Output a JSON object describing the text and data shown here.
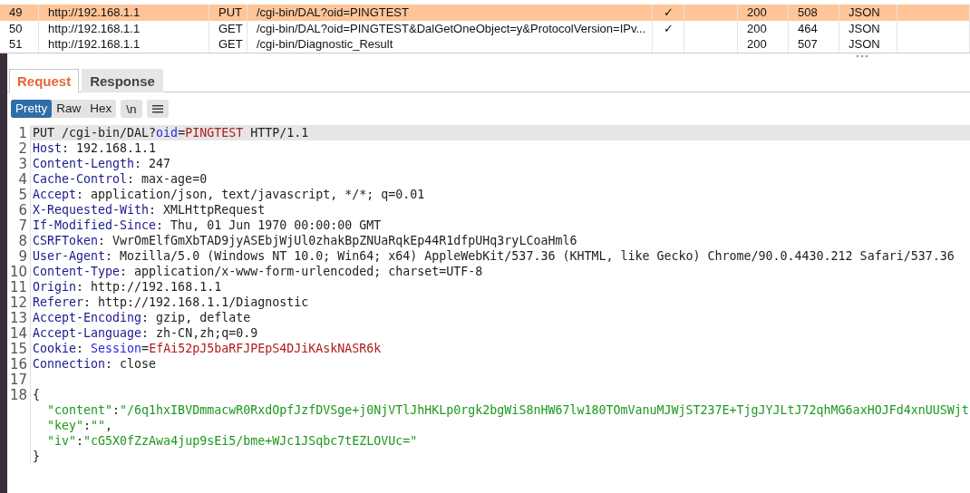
{
  "history": {
    "rows": [
      {
        "number": "49",
        "host": "http://192.168.1.1",
        "method": "PUT",
        "url": "/cgi-bin/DAL?oid=PINGTEST",
        "edited": "✓",
        "status": "200",
        "length": "508",
        "mime": "JSON",
        "selected": true
      },
      {
        "number": "50",
        "host": "http://192.168.1.1",
        "method": "GET",
        "url": "/cgi-bin/DAL?oid=PINGTEST&DalGetOneObject=y&ProtocolVersion=IPv...",
        "edited": "✓",
        "status": "200",
        "length": "464",
        "mime": "JSON",
        "selected": false
      },
      {
        "number": "51",
        "host": "http://192.168.1.1",
        "method": "GET",
        "url": "/cgi-bin/Diagnostic_Result",
        "status": "200",
        "length": "507",
        "mime": "JSON",
        "selected": false
      }
    ]
  },
  "tabs": [
    {
      "label": "Request",
      "selected": true
    },
    {
      "label": "Response",
      "selected": false
    }
  ],
  "view_modes": [
    {
      "label": "Pretty",
      "selected": true
    },
    {
      "label": "Raw",
      "selected": false
    },
    {
      "label": "Hex",
      "selected": false
    }
  ],
  "newline_toggle": "\\n",
  "request": {
    "lines": [
      {
        "number": "1",
        "highlighted": true,
        "parts": [
          {
            "kind": "text",
            "text": "PUT /cgi-bin/DAL?"
          },
          {
            "kind": "param",
            "text": "oid"
          },
          {
            "kind": "text",
            "text": "="
          },
          {
            "kind": "value",
            "text": "PINGTEST"
          },
          {
            "kind": "text",
            "text": " HTTP/1.1"
          }
        ]
      },
      {
        "number": "2",
        "highlighted": false,
        "parts": [
          {
            "kind": "name",
            "text": "Host"
          },
          {
            "kind": "text",
            "text": ": 192.168.1.1"
          }
        ]
      },
      {
        "number": "3",
        "highlighted": false,
        "parts": [
          {
            "kind": "name",
            "text": "Content-Length"
          },
          {
            "kind": "text",
            "text": ": 247"
          }
        ]
      },
      {
        "number": "4",
        "highlighted": false,
        "parts": [
          {
            "kind": "name",
            "text": "Cache-Control"
          },
          {
            "kind": "text",
            "text": ": max-age=0"
          }
        ]
      },
      {
        "number": "5",
        "highlighted": false,
        "parts": [
          {
            "kind": "name",
            "text": "Accept"
          },
          {
            "kind": "text",
            "text": ": application/json, text/javascript, */*; q=0.01"
          }
        ]
      },
      {
        "number": "6",
        "highlighted": false,
        "parts": [
          {
            "kind": "name",
            "text": "X-Requested-With"
          },
          {
            "kind": "text",
            "text": ": XMLHttpRequest"
          }
        ]
      },
      {
        "number": "7",
        "highlighted": false,
        "parts": [
          {
            "kind": "name",
            "text": "If-Modified-Since"
          },
          {
            "kind": "text",
            "text": ": Thu, 01 Jun 1970 00:00:00 GMT"
          }
        ]
      },
      {
        "number": "8",
        "highlighted": false,
        "parts": [
          {
            "kind": "name",
            "text": "CSRFToken"
          },
          {
            "kind": "text",
            "text": ": VwrOmElfGmXbTAD9jyASEbjWjUl0zhakBpZNUaRqkEp44R1dfpUHq3ryLCoaHml6"
          }
        ]
      },
      {
        "number": "9",
        "highlighted": false,
        "parts": [
          {
            "kind": "name",
            "text": "User-Agent"
          },
          {
            "kind": "text",
            "text": ": Mozilla/5.0 (Windows NT 10.0; Win64; x64) AppleWebKit/537.36 (KHTML, like Gecko) Chrome/90.0.4430.212 Safari/537.36"
          }
        ]
      },
      {
        "number": "10",
        "highlighted": false,
        "parts": [
          {
            "kind": "name",
            "text": "Content-Type"
          },
          {
            "kind": "text",
            "text": ": application/x-www-form-urlencoded; charset=UTF-8"
          }
        ]
      },
      {
        "number": "11",
        "highlighted": false,
        "parts": [
          {
            "kind": "name",
            "text": "Origin"
          },
          {
            "kind": "text",
            "text": ": http://192.168.1.1"
          }
        ]
      },
      {
        "number": "12",
        "highlighted": false,
        "parts": [
          {
            "kind": "name",
            "text": "Referer"
          },
          {
            "kind": "text",
            "text": ": http://192.168.1.1/Diagnostic"
          }
        ]
      },
      {
        "number": "13",
        "highlighted": false,
        "parts": [
          {
            "kind": "name",
            "text": "Accept-Encoding"
          },
          {
            "kind": "text",
            "text": ": gzip, deflate"
          }
        ]
      },
      {
        "number": "14",
        "highlighted": false,
        "parts": [
          {
            "kind": "name",
            "text": "Accept-Language"
          },
          {
            "kind": "text",
            "text": ": zh-CN,zh;q=0.9"
          }
        ]
      },
      {
        "number": "15",
        "highlighted": false,
        "parts": [
          {
            "kind": "name",
            "text": "Cookie"
          },
          {
            "kind": "text",
            "text": ": "
          },
          {
            "kind": "param",
            "text": "Session"
          },
          {
            "kind": "text",
            "text": "="
          },
          {
            "kind": "value",
            "text": "EfAi52pJ5baRFJPEpS4DJiKAskNASR6k"
          }
        ]
      },
      {
        "number": "16",
        "highlighted": false,
        "parts": [
          {
            "kind": "name",
            "text": "Connection"
          },
          {
            "kind": "text",
            "text": ": close"
          }
        ]
      },
      {
        "number": "17",
        "highlighted": false
      },
      {
        "number": "18",
        "highlighted": false,
        "parts": [
          {
            "kind": "text",
            "text": "{"
          }
        ]
      },
      {
        "highlighted": false,
        "parts": [
          {
            "kind": "string",
            "text": "  \"content\""
          },
          {
            "kind": "text",
            "text": ":"
          },
          {
            "kind": "string",
            "text": "\"/6q1hxIBVDmmacwR0RxdOpfJzfDVSge+j0NjVTlJhHKLp0rgk2bgWiS8nHW67lw180TOmVanuMJWjST237E+TjgJYJLtJ72qhMG6axHOJFd4xnUUSWjt"
          }
        ]
      },
      {
        "highlighted": false,
        "parts": [
          {
            "kind": "string",
            "text": "  \"key\""
          },
          {
            "kind": "text",
            "text": ":"
          },
          {
            "kind": "string",
            "text": "\"\""
          },
          {
            "kind": "text",
            "text": ","
          }
        ]
      },
      {
        "highlighted": false,
        "parts": [
          {
            "kind": "string",
            "text": "  \"iv\""
          },
          {
            "kind": "text",
            "text": ":"
          },
          {
            "kind": "string",
            "text": "\"cG5X0fZzAwa4jup9sEi5/bme+WJc1JSqbc7tEZLOVUc=\""
          }
        ]
      },
      {
        "highlighted": false,
        "parts": [
          {
            "kind": "text",
            "text": "}"
          }
        ]
      }
    ]
  }
}
